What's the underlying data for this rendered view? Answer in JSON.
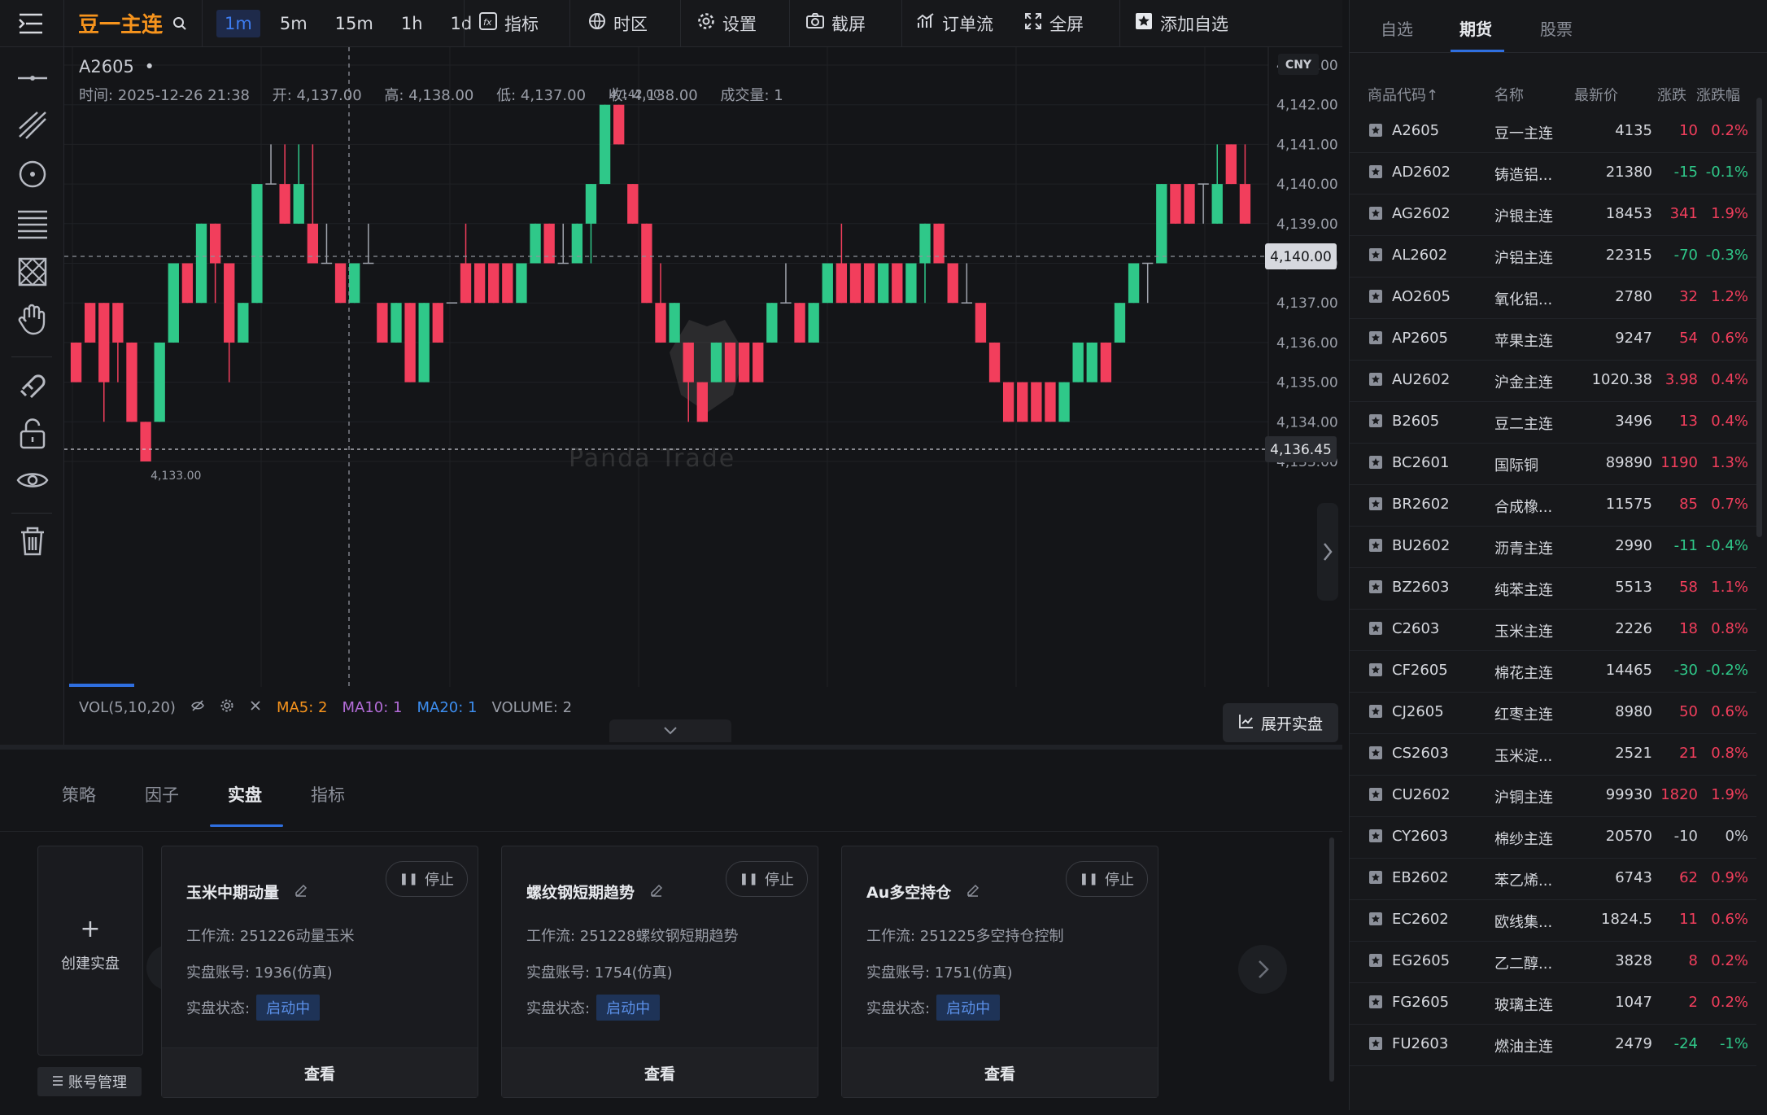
{
  "app": {
    "title": "豆一主连"
  },
  "timeframes": [
    {
      "label": "1m",
      "active": true
    },
    {
      "label": "5m",
      "active": false
    },
    {
      "label": "15m",
      "active": false
    },
    {
      "label": "1h",
      "active": false
    },
    {
      "label": "1d",
      "active": false
    }
  ],
  "toolbar": {
    "indicators": "指标",
    "timezone": "时区",
    "settings": "设置",
    "screenshot": "截屏",
    "orderflow": "订单流",
    "fullscreen": "全屏",
    "add_watch": "添加自选"
  },
  "chart": {
    "symbol": "A2605",
    "dot": "•",
    "time_label": "时间: 2025-12-26 21:38",
    "open_label": "开: 4,137.00",
    "high_label": "高: 4,138.00",
    "low_label": "低: 4,137.00",
    "close_label": "收: 4,138.00",
    "volume_label": "成交量: 1",
    "currency": "CNY",
    "max_label": "4,142.00",
    "min_label": "4,133.00",
    "crosshair_price": "4,140.00",
    "last_price": "4,136.45",
    "watermark": "Panda   Trade",
    "vol_label": "VOL(5,10,20)",
    "ma5": "MA5: 2",
    "ma10": "MA10: 1",
    "ma20": "MA20: 1",
    "volume": "VOLUME: 2",
    "expand_live": "展开实盘",
    "colors": {
      "up": "#f23e5c",
      "down": "#2fc889"
    }
  },
  "chart_data": {
    "type": "candlestick",
    "ylim": [
      4132.6,
      4143.4
    ],
    "yticks": [
      "4,143.00",
      "4,142.00",
      "4,141.00",
      "4,140.00",
      "4,139.00",
      "4,138.00",
      "4,137.00",
      "4,136.00",
      "4,135.00",
      "4,134.00",
      "4,133.00"
    ],
    "candles": [
      [
        4136,
        4135,
        4136,
        4135
      ],
      [
        4137,
        4136,
        4137,
        4136
      ],
      [
        4137,
        4135,
        4137,
        4134
      ],
      [
        4137,
        4136,
        4137,
        4135
      ],
      [
        4136,
        4134,
        4136,
        4134
      ],
      [
        4134,
        4133,
        4134,
        4133
      ],
      [
        4134,
        4136,
        4136,
        4134
      ],
      [
        4136,
        4138,
        4138,
        4136
      ],
      [
        4138,
        4137,
        4138,
        4137
      ],
      [
        4137,
        4139,
        4139,
        4137
      ],
      [
        4139,
        4138,
        4139,
        4137
      ],
      [
        4138,
        4136,
        4138,
        4135
      ],
      [
        4136,
        4137,
        4137,
        4136
      ],
      [
        4137,
        4140,
        4140,
        4137
      ],
      [
        4140,
        4140,
        4141,
        4140
      ],
      [
        4140,
        4139,
        4141,
        4139
      ],
      [
        4139,
        4140,
        4141,
        4139
      ],
      [
        4139,
        4138,
        4141,
        4138
      ],
      [
        4138,
        4138,
        4139,
        4138
      ],
      [
        4138,
        4137,
        4138,
        4137
      ],
      [
        4137,
        4138,
        4138,
        4137
      ],
      [
        4138,
        4138,
        4139,
        4138
      ],
      [
        4137,
        4136,
        4137,
        4136
      ],
      [
        4136,
        4137,
        4137,
        4136
      ],
      [
        4137,
        4135,
        4137,
        4135
      ],
      [
        4135,
        4137,
        4137,
        4135
      ],
      [
        4137,
        4136,
        4137,
        4136
      ],
      [
        4137,
        4137,
        4137,
        4137
      ],
      [
        4138,
        4137,
        4139,
        4137
      ],
      [
        4138,
        4137,
        4138,
        4137
      ],
      [
        4138,
        4137,
        4138,
        4137
      ],
      [
        4138,
        4137,
        4138,
        4137
      ],
      [
        4137,
        4138,
        4138,
        4137
      ],
      [
        4138,
        4139,
        4139,
        4138
      ],
      [
        4139,
        4138,
        4139,
        4138
      ],
      [
        4138,
        4138,
        4139,
        4138
      ],
      [
        4138,
        4139,
        4139,
        4138
      ],
      [
        4139,
        4140,
        4140,
        4138
      ],
      [
        4140,
        4142,
        4142,
        4140
      ],
      [
        4142,
        4141,
        4142,
        4141
      ],
      [
        4140,
        4139,
        4140,
        4139
      ],
      [
        4139,
        4137,
        4139,
        4137
      ],
      [
        4137,
        4136,
        4138,
        4136
      ],
      [
        4136,
        4137,
        4137,
        4136
      ],
      [
        4136,
        4135,
        4136,
        4134
      ],
      [
        4135,
        4134,
        4135,
        4134
      ],
      [
        4135,
        4136,
        4136,
        4135
      ],
      [
        4136,
        4135,
        4136,
        4135
      ],
      [
        4136,
        4135,
        4136,
        4135
      ],
      [
        4136,
        4135,
        4136,
        4135
      ],
      [
        4136,
        4137,
        4137,
        4136
      ],
      [
        4137,
        4137,
        4138,
        4137
      ],
      [
        4137,
        4136,
        4137,
        4136
      ],
      [
        4136,
        4137,
        4137,
        4136
      ],
      [
        4137,
        4138,
        4138,
        4137
      ],
      [
        4138,
        4137,
        4139,
        4137
      ],
      [
        4138,
        4137,
        4138,
        4137
      ],
      [
        4138,
        4137,
        4138,
        4137
      ],
      [
        4137,
        4138,
        4138,
        4137
      ],
      [
        4138,
        4137,
        4138,
        4137
      ],
      [
        4137,
        4138,
        4138,
        4137
      ],
      [
        4138,
        4139,
        4139,
        4137
      ],
      [
        4139,
        4138,
        4139,
        4138
      ],
      [
        4138,
        4137,
        4138,
        4137
      ],
      [
        4137,
        4137,
        4138,
        4137
      ],
      [
        4137,
        4136,
        4137,
        4136
      ],
      [
        4136,
        4135,
        4136,
        4135
      ],
      [
        4135,
        4134,
        4135,
        4134
      ],
      [
        4135,
        4134,
        4135,
        4134
      ],
      [
        4135,
        4134,
        4135,
        4134
      ],
      [
        4135,
        4134,
        4135,
        4134
      ],
      [
        4134,
        4135,
        4135,
        4134
      ],
      [
        4135,
        4136,
        4136,
        4135
      ],
      [
        4135,
        4136,
        4136,
        4135
      ],
      [
        4136,
        4135,
        4136,
        4135
      ],
      [
        4136,
        4137,
        4137,
        4136
      ],
      [
        4137,
        4138,
        4138,
        4137
      ],
      [
        4138,
        4138,
        4138,
        4137
      ],
      [
        4138,
        4140,
        4140,
        4138
      ],
      [
        4140,
        4139,
        4140,
        4139
      ],
      [
        4140,
        4139,
        4140,
        4139
      ],
      [
        4140,
        4140,
        4140,
        4139
      ],
      [
        4139,
        4140,
        4141,
        4139
      ],
      [
        4141,
        4140,
        4141,
        4140
      ],
      [
        4140,
        4139,
        4141,
        4139
      ]
    ]
  },
  "bottom": {
    "tabs": [
      {
        "label": "策略",
        "active": false
      },
      {
        "label": "因子",
        "active": false
      },
      {
        "label": "实盘",
        "active": true
      },
      {
        "label": "指标",
        "active": false
      }
    ],
    "create_label": "创建实盘",
    "plus": "+",
    "account_mgmt": "账号管理",
    "cards": [
      {
        "title": "玉米中期动量",
        "stop": "停止",
        "workflow": "工作流: 251226动量玉米",
        "account": "实盘账号: 1936(仿真)",
        "status_label": "实盘状态:",
        "status": "启动中",
        "view": "查看"
      },
      {
        "title": "螺纹钢短期趋势",
        "stop": "停止",
        "workflow": "工作流: 251228螺纹钢短期趋势",
        "account": "实盘账号: 1754(仿真)",
        "status_label": "实盘状态:",
        "status": "启动中",
        "view": "查看"
      },
      {
        "title": "Au多空持仓",
        "stop": "停止",
        "workflow": "工作流: 251225多空持仓控制",
        "account": "实盘账号: 1751(仿真)",
        "status_label": "实盘状态:",
        "status": "启动中",
        "view": "查看"
      }
    ]
  },
  "right": {
    "tabs": [
      {
        "label": "自选",
        "active": false
      },
      {
        "label": "期货",
        "active": true
      },
      {
        "label": "股票",
        "active": false
      }
    ],
    "headers": [
      "商品代码↑",
      "名称",
      "最新价",
      "涨跌",
      "涨跌幅"
    ],
    "rows": [
      {
        "code": "A2605",
        "name": "豆一主连",
        "price": "4135",
        "chg": "10",
        "pct": "0.2%",
        "dir": "up"
      },
      {
        "code": "AD2602",
        "name": "铸造铝...",
        "price": "21380",
        "chg": "-15",
        "pct": "-0.1%",
        "dir": "dn"
      },
      {
        "code": "AG2602",
        "name": "沪银主连",
        "price": "18453",
        "chg": "341",
        "pct": "1.9%",
        "dir": "up"
      },
      {
        "code": "AL2602",
        "name": "沪铝主连",
        "price": "22315",
        "chg": "-70",
        "pct": "-0.3%",
        "dir": "dn"
      },
      {
        "code": "AO2605",
        "name": "氧化铝...",
        "price": "2780",
        "chg": "32",
        "pct": "1.2%",
        "dir": "up"
      },
      {
        "code": "AP2605",
        "name": "苹果主连",
        "price": "9247",
        "chg": "54",
        "pct": "0.6%",
        "dir": "up"
      },
      {
        "code": "AU2602",
        "name": "沪金主连",
        "price": "1020.38",
        "chg": "3.98",
        "pct": "0.4%",
        "dir": "up"
      },
      {
        "code": "B2605",
        "name": "豆二主连",
        "price": "3496",
        "chg": "13",
        "pct": "0.4%",
        "dir": "up"
      },
      {
        "code": "BC2601",
        "name": "国际铜",
        "price": "89890",
        "chg": "1190",
        "pct": "1.3%",
        "dir": "up"
      },
      {
        "code": "BR2602",
        "name": "合成橡...",
        "price": "11575",
        "chg": "85",
        "pct": "0.7%",
        "dir": "up"
      },
      {
        "code": "BU2602",
        "name": "沥青主连",
        "price": "2990",
        "chg": "-11",
        "pct": "-0.4%",
        "dir": "dn"
      },
      {
        "code": "BZ2603",
        "name": "纯苯主连",
        "price": "5513",
        "chg": "58",
        "pct": "1.1%",
        "dir": "up"
      },
      {
        "code": "C2603",
        "name": "玉米主连",
        "price": "2226",
        "chg": "18",
        "pct": "0.8%",
        "dir": "up"
      },
      {
        "code": "CF2605",
        "name": "棉花主连",
        "price": "14465",
        "chg": "-30",
        "pct": "-0.2%",
        "dir": "dn"
      },
      {
        "code": "CJ2605",
        "name": "红枣主连",
        "price": "8980",
        "chg": "50",
        "pct": "0.6%",
        "dir": "up"
      },
      {
        "code": "CS2603",
        "name": "玉米淀...",
        "price": "2521",
        "chg": "21",
        "pct": "0.8%",
        "dir": "up"
      },
      {
        "code": "CU2602",
        "name": "沪铜主连",
        "price": "99930",
        "chg": "1820",
        "pct": "1.9%",
        "dir": "up"
      },
      {
        "code": "CY2603",
        "name": "棉纱主连",
        "price": "20570",
        "chg": "-10",
        "pct": "0%",
        "dir": "flat"
      },
      {
        "code": "EB2602",
        "name": "苯乙烯...",
        "price": "6743",
        "chg": "62",
        "pct": "0.9%",
        "dir": "up"
      },
      {
        "code": "EC2602",
        "name": "欧线集...",
        "price": "1824.5",
        "chg": "11",
        "pct": "0.6%",
        "dir": "up"
      },
      {
        "code": "EG2605",
        "name": "乙二醇...",
        "price": "3828",
        "chg": "8",
        "pct": "0.2%",
        "dir": "up"
      },
      {
        "code": "FG2605",
        "name": "玻璃主连",
        "price": "1047",
        "chg": "2",
        "pct": "0.2%",
        "dir": "up"
      },
      {
        "code": "FU2603",
        "name": "燃油主连",
        "price": "2479",
        "chg": "-24",
        "pct": "-1%",
        "dir": "dn"
      }
    ]
  }
}
